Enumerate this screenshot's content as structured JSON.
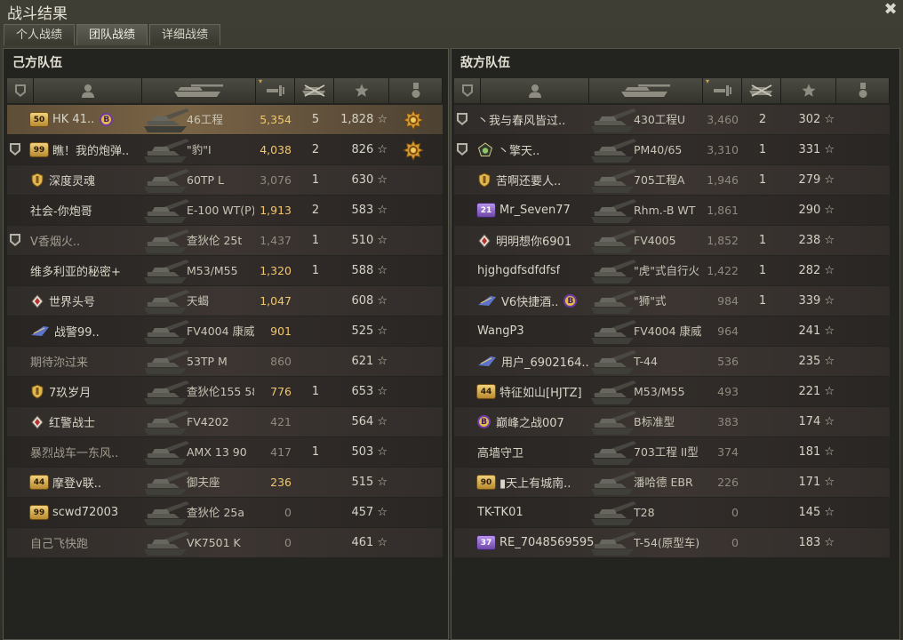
{
  "window": {
    "title": "战斗结果"
  },
  "tabs": [
    {
      "label": "个人战绩",
      "active": false
    },
    {
      "label": "团队战绩",
      "active": true
    },
    {
      "label": "详细战绩",
      "active": false
    }
  ],
  "colors": {
    "damage_highlight": "#f0c76c",
    "row_highlight": "#7a6446",
    "panel_bg": "#23231f"
  },
  "teams": [
    {
      "title": "己方队伍",
      "players": [
        {
          "icon": "",
          "badge": "50",
          "badge_style": "num",
          "name": "HK 41..",
          "bond": "B",
          "vehicle": "46工程",
          "damage": "5,354",
          "kills": "5",
          "xp": "1,828",
          "medal": "medal-icon",
          "highlight": true,
          "dim_damage": false
        },
        {
          "icon": "shield-icon",
          "badge": "99",
          "badge_style": "num",
          "name": "瞧！我的炮弹..",
          "bond": "",
          "vehicle": "\"豹\"I",
          "damage": "4,038",
          "kills": "2",
          "xp": "826",
          "medal": "medal-icon",
          "highlight": false,
          "dim_damage": false
        },
        {
          "icon": "",
          "badge": "shield",
          "badge_style": "shield",
          "name": "深度灵魂",
          "bond": "",
          "vehicle": "60TP L",
          "damage": "3,076",
          "kills": "1",
          "xp": "630",
          "medal": "",
          "highlight": false,
          "dim_damage": true
        },
        {
          "icon": "",
          "badge": "",
          "badge_style": "",
          "name": "社会-你炮哥",
          "bond": "",
          "vehicle": "E-100 WT(P)",
          "damage": "1,913",
          "kills": "2",
          "xp": "583",
          "medal": "",
          "highlight": false,
          "dim_damage": false
        },
        {
          "icon": "shield-icon",
          "badge": "",
          "badge_style": "",
          "name": "V香烟火..",
          "bond": "",
          "vehicle": "查狄伦 25t",
          "damage": "1,437",
          "kills": "1",
          "xp": "510",
          "medal": "",
          "highlight": false,
          "dim_damage": true
        },
        {
          "icon": "",
          "badge": "",
          "badge_style": "",
          "name": "维多利亚的秘密+",
          "bond": "",
          "vehicle": "M53/M55",
          "damage": "1,320",
          "kills": "1",
          "xp": "588",
          "medal": "",
          "highlight": false,
          "dim_damage": false
        },
        {
          "icon": "",
          "badge": "diamond",
          "badge_style": "diamond",
          "name": "世界头号",
          "bond": "",
          "vehicle": "天蝎",
          "damage": "1,047",
          "kills": "",
          "xp": "608",
          "medal": "",
          "highlight": false,
          "dim_damage": false
        },
        {
          "icon": "",
          "badge": "wing",
          "badge_style": "wing",
          "name": "战警99..",
          "bond": "",
          "vehicle": "FV4004 康威",
          "damage": "901",
          "kills": "",
          "xp": "525",
          "medal": "",
          "highlight": false,
          "dim_damage": false
        },
        {
          "icon": "",
          "badge": "",
          "badge_style": "",
          "name": "期待沵过来",
          "bond": "",
          "vehicle": "53TP M",
          "damage": "860",
          "kills": "",
          "xp": "621",
          "medal": "",
          "highlight": false,
          "dim_damage": true
        },
        {
          "icon": "",
          "badge": "shield",
          "badge_style": "shield",
          "name": "7玖岁月",
          "bond": "",
          "vehicle": "查狄伦155 58",
          "damage": "776",
          "kills": "1",
          "xp": "653",
          "medal": "",
          "highlight": false,
          "dim_damage": false
        },
        {
          "icon": "",
          "badge": "diamond",
          "badge_style": "diamond",
          "name": "红警战士",
          "bond": "",
          "vehicle": "FV4202",
          "damage": "421",
          "kills": "",
          "xp": "564",
          "medal": "",
          "highlight": false,
          "dim_damage": true
        },
        {
          "icon": "",
          "badge": "",
          "badge_style": "",
          "name": "暴烈战车一东风..",
          "bond": "",
          "vehicle": "AMX 13 90",
          "damage": "417",
          "kills": "1",
          "xp": "503",
          "medal": "",
          "highlight": false,
          "dim_damage": true
        },
        {
          "icon": "",
          "badge": "44",
          "badge_style": "num",
          "name": "摩登v联..",
          "bond": "",
          "vehicle": "御夫座",
          "damage": "236",
          "kills": "",
          "xp": "515",
          "medal": "",
          "highlight": false,
          "dim_damage": false
        },
        {
          "icon": "",
          "badge": "99",
          "badge_style": "num",
          "name": "scwd72003",
          "bond": "",
          "vehicle": "查狄伦 25a",
          "damage": "0",
          "kills": "",
          "xp": "457",
          "medal": "",
          "highlight": false,
          "dim_damage": true
        },
        {
          "icon": "",
          "badge": "",
          "badge_style": "",
          "name": "自己飞快跑",
          "bond": "",
          "vehicle": "VK7501 K",
          "damage": "0",
          "kills": "",
          "xp": "461",
          "medal": "",
          "highlight": false,
          "dim_damage": true
        }
      ]
    },
    {
      "title": "敌方队伍",
      "players": [
        {
          "icon": "shield-icon",
          "badge": "",
          "badge_style": "",
          "name": "丶我与春风皆过..",
          "bond": "",
          "vehicle": "430工程U",
          "damage": "3,460",
          "kills": "2",
          "xp": "302",
          "medal": "",
          "highlight": false,
          "dim_damage": true
        },
        {
          "icon": "shield-icon",
          "badge": "pentagon",
          "badge_style": "pentagon",
          "name": "丶擎天..",
          "bond": "",
          "vehicle": "PM40/65",
          "damage": "3,310",
          "kills": "1",
          "xp": "331",
          "medal": "",
          "highlight": false,
          "dim_damage": true
        },
        {
          "icon": "",
          "badge": "shield",
          "badge_style": "shield",
          "name": "苦啊还要人..",
          "bond": "",
          "vehicle": "705工程A",
          "damage": "1,946",
          "kills": "1",
          "xp": "279",
          "medal": "",
          "highlight": false,
          "dim_damage": true
        },
        {
          "icon": "",
          "badge": "21",
          "badge_style": "num purple",
          "name": "Mr_Seven77",
          "bond": "",
          "vehicle": "Rhm.-B WT",
          "damage": "1,861",
          "kills": "",
          "xp": "290",
          "medal": "",
          "highlight": false,
          "dim_damage": true
        },
        {
          "icon": "",
          "badge": "diamond",
          "badge_style": "diamond",
          "name": "明明想你6901",
          "bond": "",
          "vehicle": "FV4005",
          "damage": "1,852",
          "kills": "1",
          "xp": "238",
          "medal": "",
          "highlight": false,
          "dim_damage": true
        },
        {
          "icon": "",
          "badge": "",
          "badge_style": "",
          "name": "hjghgdfsdfdfsf",
          "bond": "",
          "vehicle": "\"虎\"式自行火",
          "damage": "1,422",
          "kills": "1",
          "xp": "282",
          "medal": "",
          "highlight": false,
          "dim_damage": true
        },
        {
          "icon": "",
          "badge": "wing",
          "badge_style": "wing",
          "name": "V6快捷酒..",
          "bond": "B",
          "vehicle": "\"狮\"式",
          "damage": "984",
          "kills": "1",
          "xp": "339",
          "medal": "",
          "highlight": false,
          "dim_damage": true
        },
        {
          "icon": "",
          "badge": "",
          "badge_style": "",
          "name": "WangP3",
          "bond": "",
          "vehicle": "FV4004 康威",
          "damage": "964",
          "kills": "",
          "xp": "241",
          "medal": "",
          "highlight": false,
          "dim_damage": true
        },
        {
          "icon": "",
          "badge": "wing",
          "badge_style": "wing",
          "name": "用户_6902164..",
          "bond": "",
          "vehicle": "T-44",
          "damage": "536",
          "kills": "",
          "xp": "235",
          "medal": "",
          "highlight": false,
          "dim_damage": true
        },
        {
          "icon": "",
          "badge": "44",
          "badge_style": "num",
          "name": "特征如山[HJTZ]",
          "bond": "",
          "vehicle": "M53/M55",
          "damage": "493",
          "kills": "",
          "xp": "221",
          "medal": "",
          "highlight": false,
          "dim_damage": true
        },
        {
          "icon": "",
          "badge": "B",
          "badge_style": "bondb",
          "name": "巅峰之战007",
          "bond": "",
          "vehicle": "B标准型",
          "damage": "383",
          "kills": "",
          "xp": "174",
          "medal": "",
          "highlight": false,
          "dim_damage": true
        },
        {
          "icon": "",
          "badge": "",
          "badge_style": "",
          "name": "高墙守卫",
          "bond": "",
          "vehicle": "703工程 II型",
          "damage": "374",
          "kills": "",
          "xp": "181",
          "medal": "",
          "highlight": false,
          "dim_damage": true
        },
        {
          "icon": "",
          "badge": "90",
          "badge_style": "num",
          "name": "▮天上有城南..",
          "bond": "",
          "vehicle": "潘哈德 EBR",
          "damage": "226",
          "kills": "",
          "xp": "171",
          "medal": "",
          "highlight": false,
          "dim_damage": true
        },
        {
          "icon": "",
          "badge": "",
          "badge_style": "",
          "name": "TK-TK01",
          "bond": "",
          "vehicle": "T28",
          "damage": "0",
          "kills": "",
          "xp": "145",
          "medal": "",
          "highlight": false,
          "dim_damage": true
        },
        {
          "icon": "",
          "badge": "37",
          "badge_style": "num purple",
          "name": "RE_7048569595",
          "bond": "",
          "vehicle": "T-54(原型车)",
          "damage": "0",
          "kills": "",
          "xp": "183",
          "medal": "",
          "highlight": false,
          "dim_damage": true
        }
      ]
    }
  ],
  "columns": [
    "platoon-icon",
    "player-icon",
    "vehicle-icon",
    "damage-icon",
    "kills-icon",
    "xp-star-icon",
    "medal-column-icon"
  ]
}
